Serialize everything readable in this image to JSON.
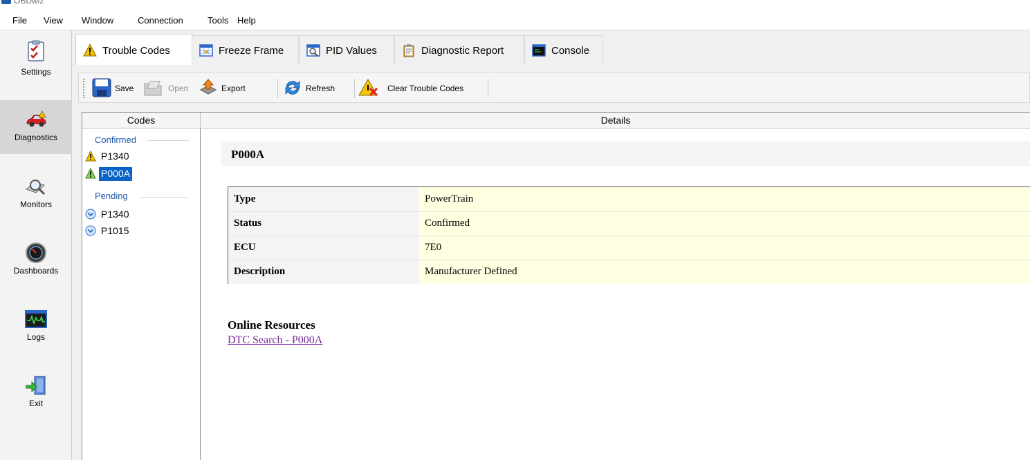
{
  "app": {
    "title": "OBDwiz"
  },
  "menu": [
    "File",
    "View",
    "Window",
    "Connection",
    "Tools",
    "Help"
  ],
  "sidebar": {
    "items": [
      {
        "label": "Settings",
        "icon": "checklist-icon",
        "active": false
      },
      {
        "label": "Diagnostics",
        "icon": "car-icon",
        "active": true
      },
      {
        "label": "Monitors",
        "icon": "magnifier-icon",
        "active": false
      },
      {
        "label": "Dashboards",
        "icon": "gauge-icon",
        "active": false
      },
      {
        "label": "Logs",
        "icon": "waveform-icon",
        "active": false
      },
      {
        "label": "Exit",
        "icon": "exit-door-icon",
        "active": false
      }
    ]
  },
  "tabs": [
    {
      "label": "Trouble Codes",
      "icon": "warning-icon",
      "active": true
    },
    {
      "label": "Freeze Frame",
      "icon": "grid-icon",
      "active": false
    },
    {
      "label": "PID Values",
      "icon": "magnify-table-icon",
      "active": false
    },
    {
      "label": "Diagnostic Report",
      "icon": "clipboard-icon",
      "active": false
    },
    {
      "label": "Console",
      "icon": "console-icon",
      "active": false
    }
  ],
  "toolbar": {
    "save_label": "Save",
    "open_label": "Open",
    "export_label": "Export",
    "refresh_label": "Refresh",
    "clear_label": "Clear Trouble Codes"
  },
  "codes": {
    "header": "Codes",
    "confirmed_label": "Confirmed",
    "confirmed": [
      {
        "code": "P1340",
        "icon": "warning-yellow-icon",
        "selected": false
      },
      {
        "code": "P000A",
        "icon": "warning-green-icon",
        "selected": true
      }
    ],
    "pending_label": "Pending",
    "pending": [
      {
        "code": "P1340",
        "icon": "pending-chevron-icon",
        "selected": false
      },
      {
        "code": "P1015",
        "icon": "pending-chevron-icon",
        "selected": false
      }
    ]
  },
  "details": {
    "header": "Details",
    "title": "P000A",
    "rows": [
      {
        "key": "Type",
        "value": "PowerTrain"
      },
      {
        "key": "Status",
        "value": "Confirmed"
      },
      {
        "key": "ECU",
        "value": "7E0"
      },
      {
        "key": "Description",
        "value": "Manufacturer Defined"
      }
    ],
    "online_title": "Online Resources",
    "online_link": "DTC Search - P000A"
  }
}
